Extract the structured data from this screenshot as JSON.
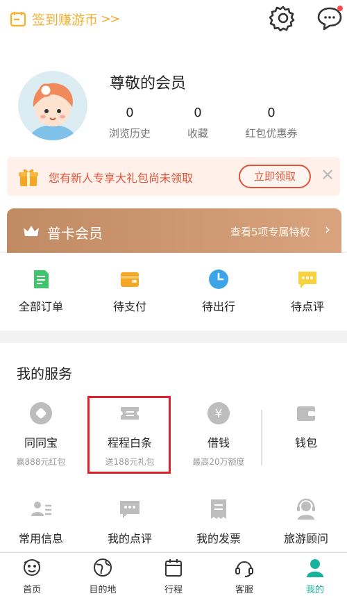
{
  "topbar": {
    "checkin_label": "签到赚游币",
    "checkin_arrow": ">>",
    "settings_icon": "gear-icon",
    "message_icon": "chat-bubble-icon"
  },
  "profile": {
    "member_name": "尊敬的会员",
    "stats": [
      {
        "value": "0",
        "label": "浏览历史"
      },
      {
        "value": "0",
        "label": "收藏"
      },
      {
        "value": "0",
        "label": "红包优惠券"
      }
    ]
  },
  "promo": {
    "text": "您有新人专享大礼包尚未领取",
    "button": "立即领取",
    "close": "✕"
  },
  "vip": {
    "title": "普卡会员",
    "link": "查看5项专属特权",
    "chevron": "›"
  },
  "orders": [
    {
      "label": "全部订单",
      "icon": "document-icon"
    },
    {
      "label": "待支付",
      "icon": "wallet-icon"
    },
    {
      "label": "待出行",
      "icon": "clock-icon"
    },
    {
      "label": "待点评",
      "icon": "comment-icon"
    }
  ],
  "services": {
    "title": "我的服务",
    "items": [
      {
        "label": "同同宝",
        "sub": "赢888元红包",
        "icon": "coin-icon"
      },
      {
        "label": "程程白条",
        "sub": "送188元礼包",
        "icon": "ticket-icon"
      },
      {
        "label": "借钱",
        "sub": "最高20万额度",
        "icon": "yen-icon"
      },
      {
        "label": "钱包",
        "sub": "",
        "icon": "wallet-icon"
      },
      {
        "label": "常用信息",
        "sub": "",
        "icon": "contact-card-icon"
      },
      {
        "label": "我的点评",
        "sub": "",
        "icon": "comment-icon"
      },
      {
        "label": "我的发票",
        "sub": "",
        "icon": "invoice-icon"
      },
      {
        "label": "旅游顾问",
        "sub": "",
        "icon": "headset-advisor-icon"
      }
    ]
  },
  "tabs": [
    {
      "label": "首页",
      "icon": "home-mascot-icon"
    },
    {
      "label": "目的地",
      "icon": "globe-icon"
    },
    {
      "label": "行程",
      "icon": "calendar-icon"
    },
    {
      "label": "客服",
      "icon": "headset-icon"
    },
    {
      "label": "我的",
      "icon": "user-icon",
      "active": true
    }
  ],
  "colors": {
    "accent": "#19b29a",
    "checkin": "#f2b233",
    "promo": "#e0533a",
    "vip_start": "#c08a63",
    "vip_end": "#d8a37e",
    "highlight": "#e0202a"
  }
}
